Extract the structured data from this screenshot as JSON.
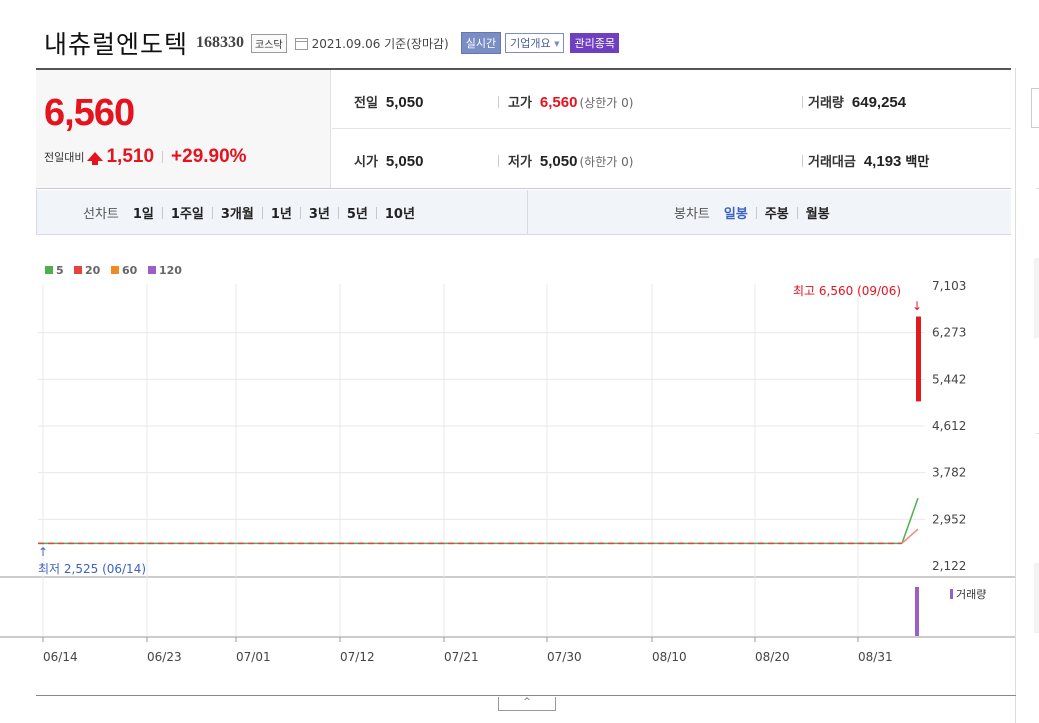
{
  "header": {
    "name": "내츄럴엔도텍",
    "code": "168330",
    "market": "코스닥",
    "date": "2021.09.06 기준(장마감)",
    "realtime": "실시간",
    "company": "기업개요",
    "dropdown_arrow": "▼",
    "managed": "관리종목"
  },
  "quote": {
    "price": "6,560",
    "change_label": "전일대비",
    "change_value": "1,510",
    "change_rate": "+29.90%",
    "prev_label": "전일",
    "prev_value": "5,050",
    "high_label": "고가",
    "high_value": "6,560",
    "high_limit": "(상한가 0)",
    "volume_label": "거래량",
    "volume_value": "649,254",
    "open_label": "시가",
    "open_value": "5,050",
    "low_label": "저가",
    "low_value": "5,050",
    "low_limit": "(하한가 0)",
    "amount_label": "거래대금",
    "amount_value": "4,193",
    "amount_unit": "백만"
  },
  "periods": {
    "line_title": "선차트",
    "line_options": [
      "1일",
      "1주일",
      "3개월",
      "1년",
      "3년",
      "5년",
      "10년"
    ],
    "candle_title": "봉차트",
    "candle_options": [
      "일봉",
      "주봉",
      "월봉"
    ],
    "candle_active": "일봉"
  },
  "chart_data": {
    "type": "candlestick",
    "legend": [
      {
        "name": "5",
        "color": "#4cb050"
      },
      {
        "name": "20",
        "color": "#e8423f"
      },
      {
        "name": "60",
        "color": "#f08a24"
      },
      {
        "name": "120",
        "color": "#9a5fc8"
      }
    ],
    "y_ticks": [
      "7,103",
      "6,273",
      "5,442",
      "4,612",
      "3,782",
      "2,952",
      "2,122"
    ],
    "ylim": [
      2122,
      7103
    ],
    "x_ticks": [
      "06/14",
      "06/23",
      "07/01",
      "07/12",
      "07/21",
      "07/30",
      "08/10",
      "08/20",
      "08/31"
    ],
    "annotation_high": "최고 6,560 (09/06)",
    "annotation_low": "최저 2,525 (06/14)",
    "arrow_down": "↓",
    "arrow_up": "↑",
    "flat_price": 2525,
    "last_candle": {
      "date": "09/06",
      "open": 5050,
      "high": 6560,
      "low": 5050,
      "close": 6560
    },
    "ma_end": {
      "ma5": 3330,
      "ma20": 2780
    },
    "volume_label": "거래량"
  },
  "toggle": "^"
}
